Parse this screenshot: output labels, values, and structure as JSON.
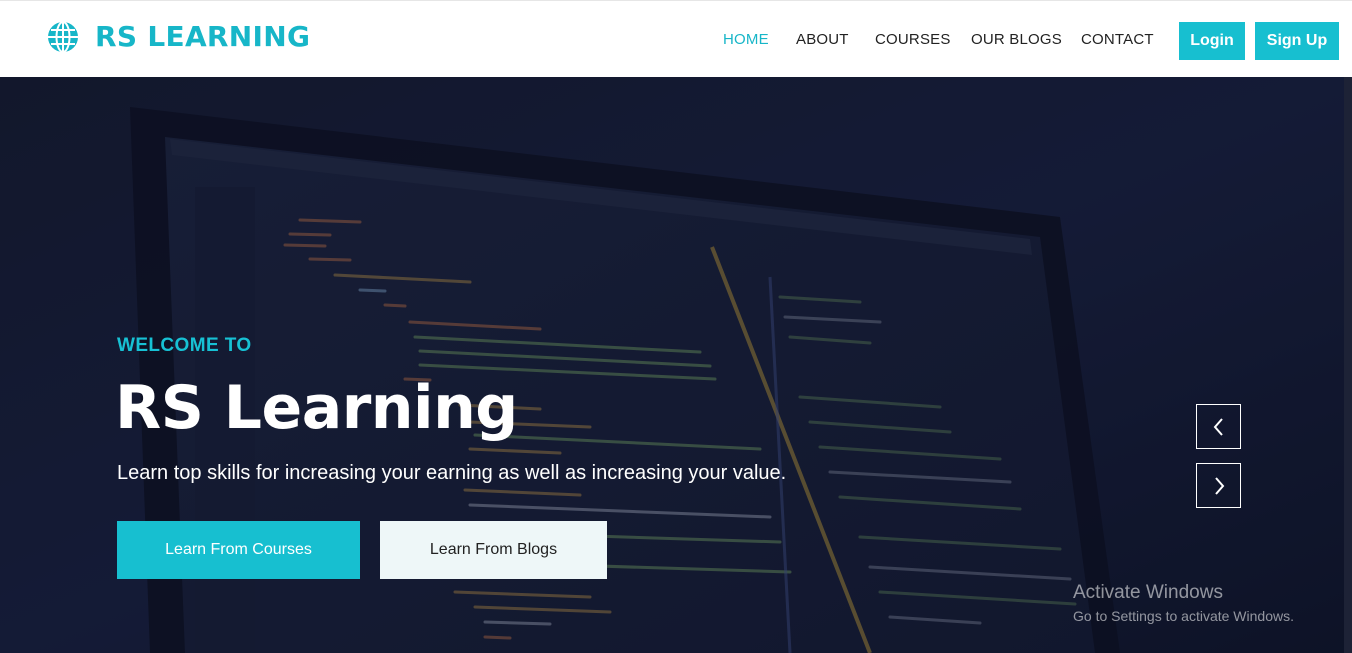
{
  "brand": {
    "name": "RS LEARNING",
    "icon": "globe-icon",
    "color": "#17b6c8"
  },
  "nav": {
    "items": [
      {
        "label": "HOME",
        "active": true
      },
      {
        "label": "ABOUT",
        "active": false
      },
      {
        "label": "COURSES",
        "active": false
      },
      {
        "label": "OUR BLOGS",
        "active": false
      },
      {
        "label": "CONTACT",
        "active": false
      }
    ],
    "login_label": "Login",
    "signup_label": "Sign Up"
  },
  "hero": {
    "eyebrow": "WELCOME TO",
    "title": "RS Learning",
    "subtitle": "Learn top skills for increasing your earning as well as increasing your value.",
    "primary_cta": "Learn From Courses",
    "secondary_cta": "Learn From Blogs",
    "prev_icon": "chevron-left-icon",
    "next_icon": "chevron-right-icon"
  },
  "os_watermark": {
    "title": "Activate Windows",
    "message": "Go to Settings to activate Windows."
  },
  "colors": {
    "accent": "#17bfd0",
    "hero_bg": "#141a33"
  }
}
